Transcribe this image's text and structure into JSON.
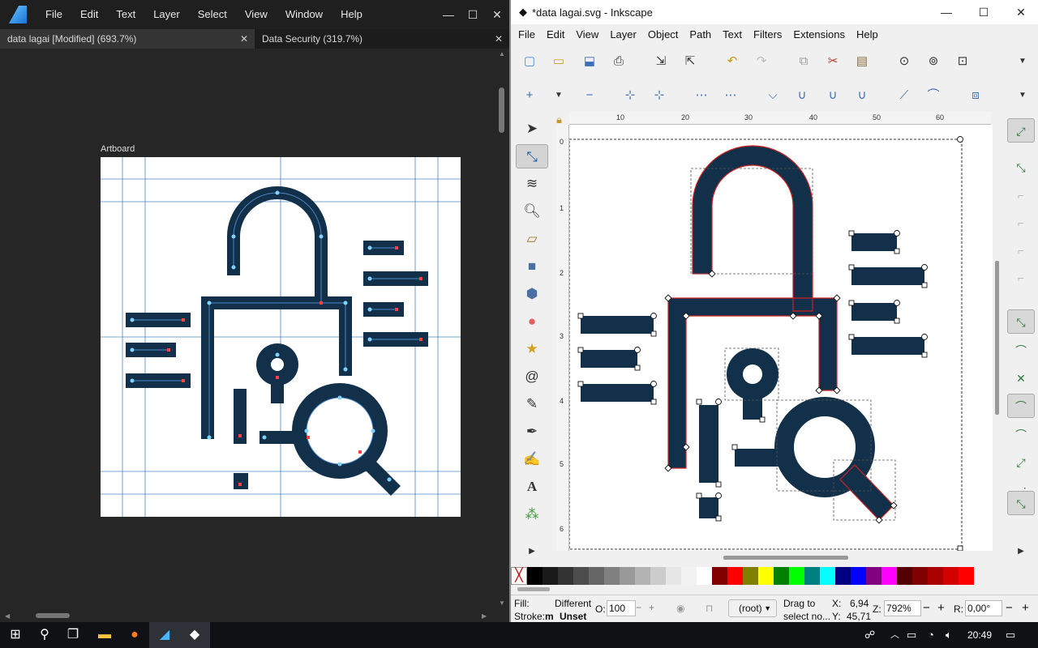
{
  "affinity": {
    "menu": [
      "File",
      "Edit",
      "Text",
      "Layer",
      "Select",
      "View",
      "Window",
      "Help"
    ],
    "window_controls": {
      "minimize": "—",
      "maximize": "☐",
      "close": "✕"
    },
    "tabs": [
      {
        "label": "data lagai [Modified] (693.7%)",
        "close": "✕"
      },
      {
        "label": "Data Security (319.7%)",
        "close": "✕"
      }
    ],
    "artboard_label": "Artboard"
  },
  "inkscape": {
    "title": "*data lagai.svg - Inkscape",
    "window_controls": {
      "minimize": "—",
      "maximize": "☐",
      "close": "✕"
    },
    "menu": [
      "File",
      "Edit",
      "View",
      "Layer",
      "Object",
      "Path",
      "Text",
      "Filters",
      "Extensions",
      "Help"
    ],
    "ruler_h": [
      "10",
      "20",
      "30",
      "40",
      "50",
      "60"
    ],
    "ruler_v": [
      "0",
      "1",
      "2",
      "3",
      "4",
      "5",
      "6"
    ],
    "status": {
      "fill_label": "Fill:",
      "fill_value": "Different",
      "stroke_label": "Stroke:",
      "stroke_value_short": "m",
      "stroke_value": "Unset",
      "opacity_label": "O:",
      "opacity_value": "100",
      "layer": "(root)",
      "message_line1": "Drag to",
      "message_line2": "select no...",
      "x_label": "X:",
      "x_value": "6,94",
      "y_label": "Y:",
      "y_value": "45,71",
      "zoom_label": "Z:",
      "zoom_value": "792%",
      "rotation_label": "R:",
      "rotation_value": "0,00°"
    },
    "palette": [
      "#000000",
      "#1a1a1a",
      "#333333",
      "#4d4d4d",
      "#666666",
      "#808080",
      "#999999",
      "#b3b3b3",
      "#cccccc",
      "#e6e6e6",
      "#f2f2f2",
      "#ffffff",
      "#800000",
      "#ff0000",
      "#808000",
      "#ffff00",
      "#008000",
      "#00ff00",
      "#008080",
      "#00ffff",
      "#000080",
      "#0000ff",
      "#800080",
      "#ff00ff",
      "#550000",
      "#800000",
      "#aa0000",
      "#d40000",
      "#ff0000"
    ]
  },
  "taskbar": {
    "clock": "20:49"
  },
  "colors": {
    "icon_fill": "#12304a",
    "guide": "#4a86c5",
    "node": "#ff4040",
    "selection_red": "#cc2222"
  }
}
